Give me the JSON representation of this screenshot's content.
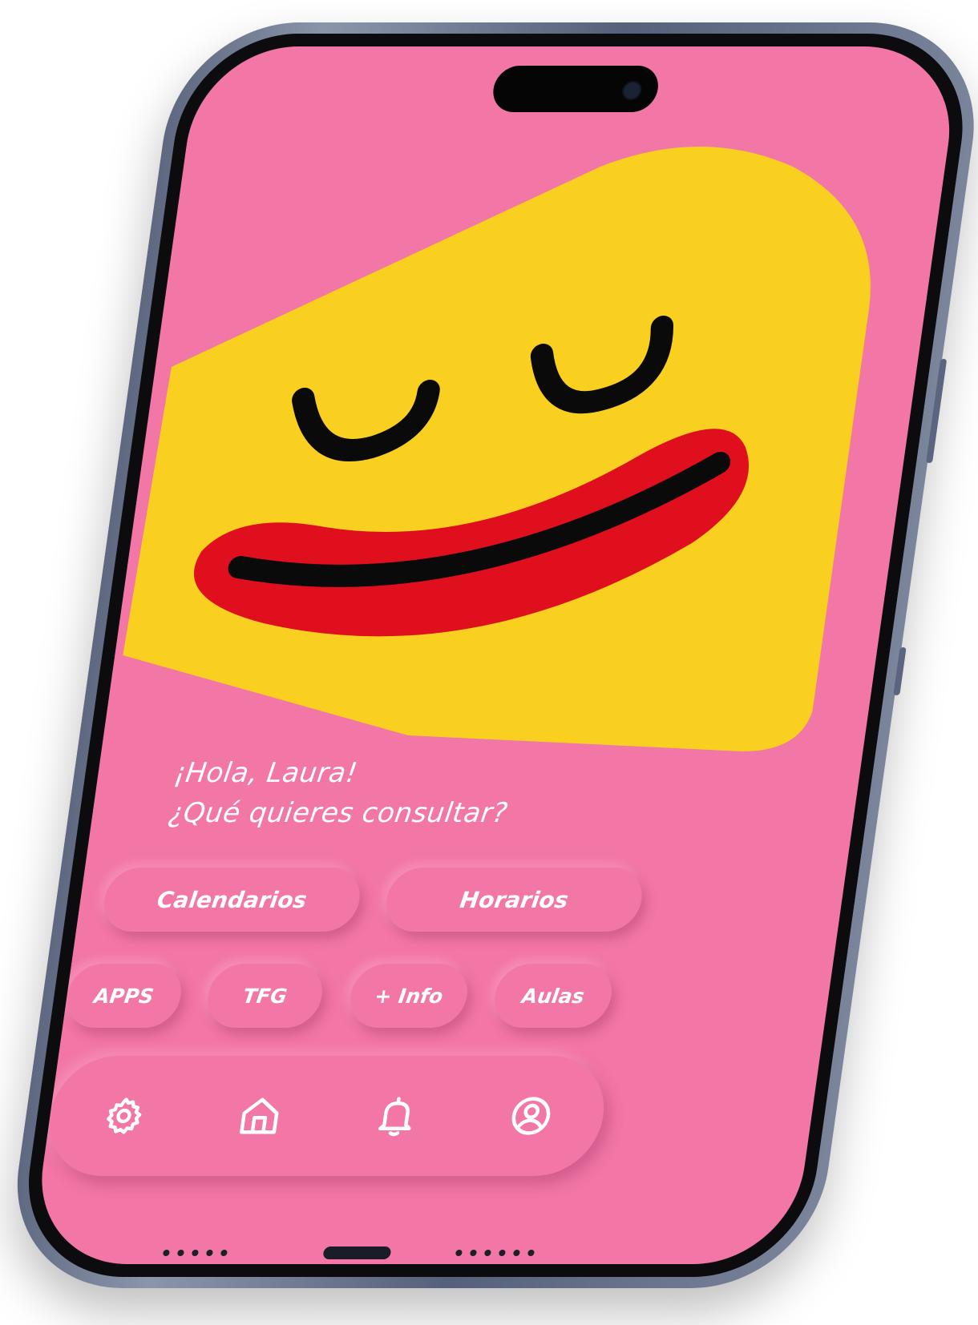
{
  "greeting": {
    "line1": "¡Hola, Laura!",
    "line2": "¿Qué quieres consultar?"
  },
  "buttons": {
    "calendarios": "Calendarios",
    "horarios": "Horarios",
    "apps": "APPS",
    "tfg": "TFG",
    "info": "+ Info",
    "aulas": "Aulas"
  },
  "nav": {
    "icons": [
      "gear-icon",
      "home-icon",
      "bell-icon",
      "user-icon"
    ]
  },
  "colors": {
    "background": "#f276a6",
    "face": "#f9d01f",
    "lips": "#e00f1e",
    "text": "#ffffff"
  }
}
